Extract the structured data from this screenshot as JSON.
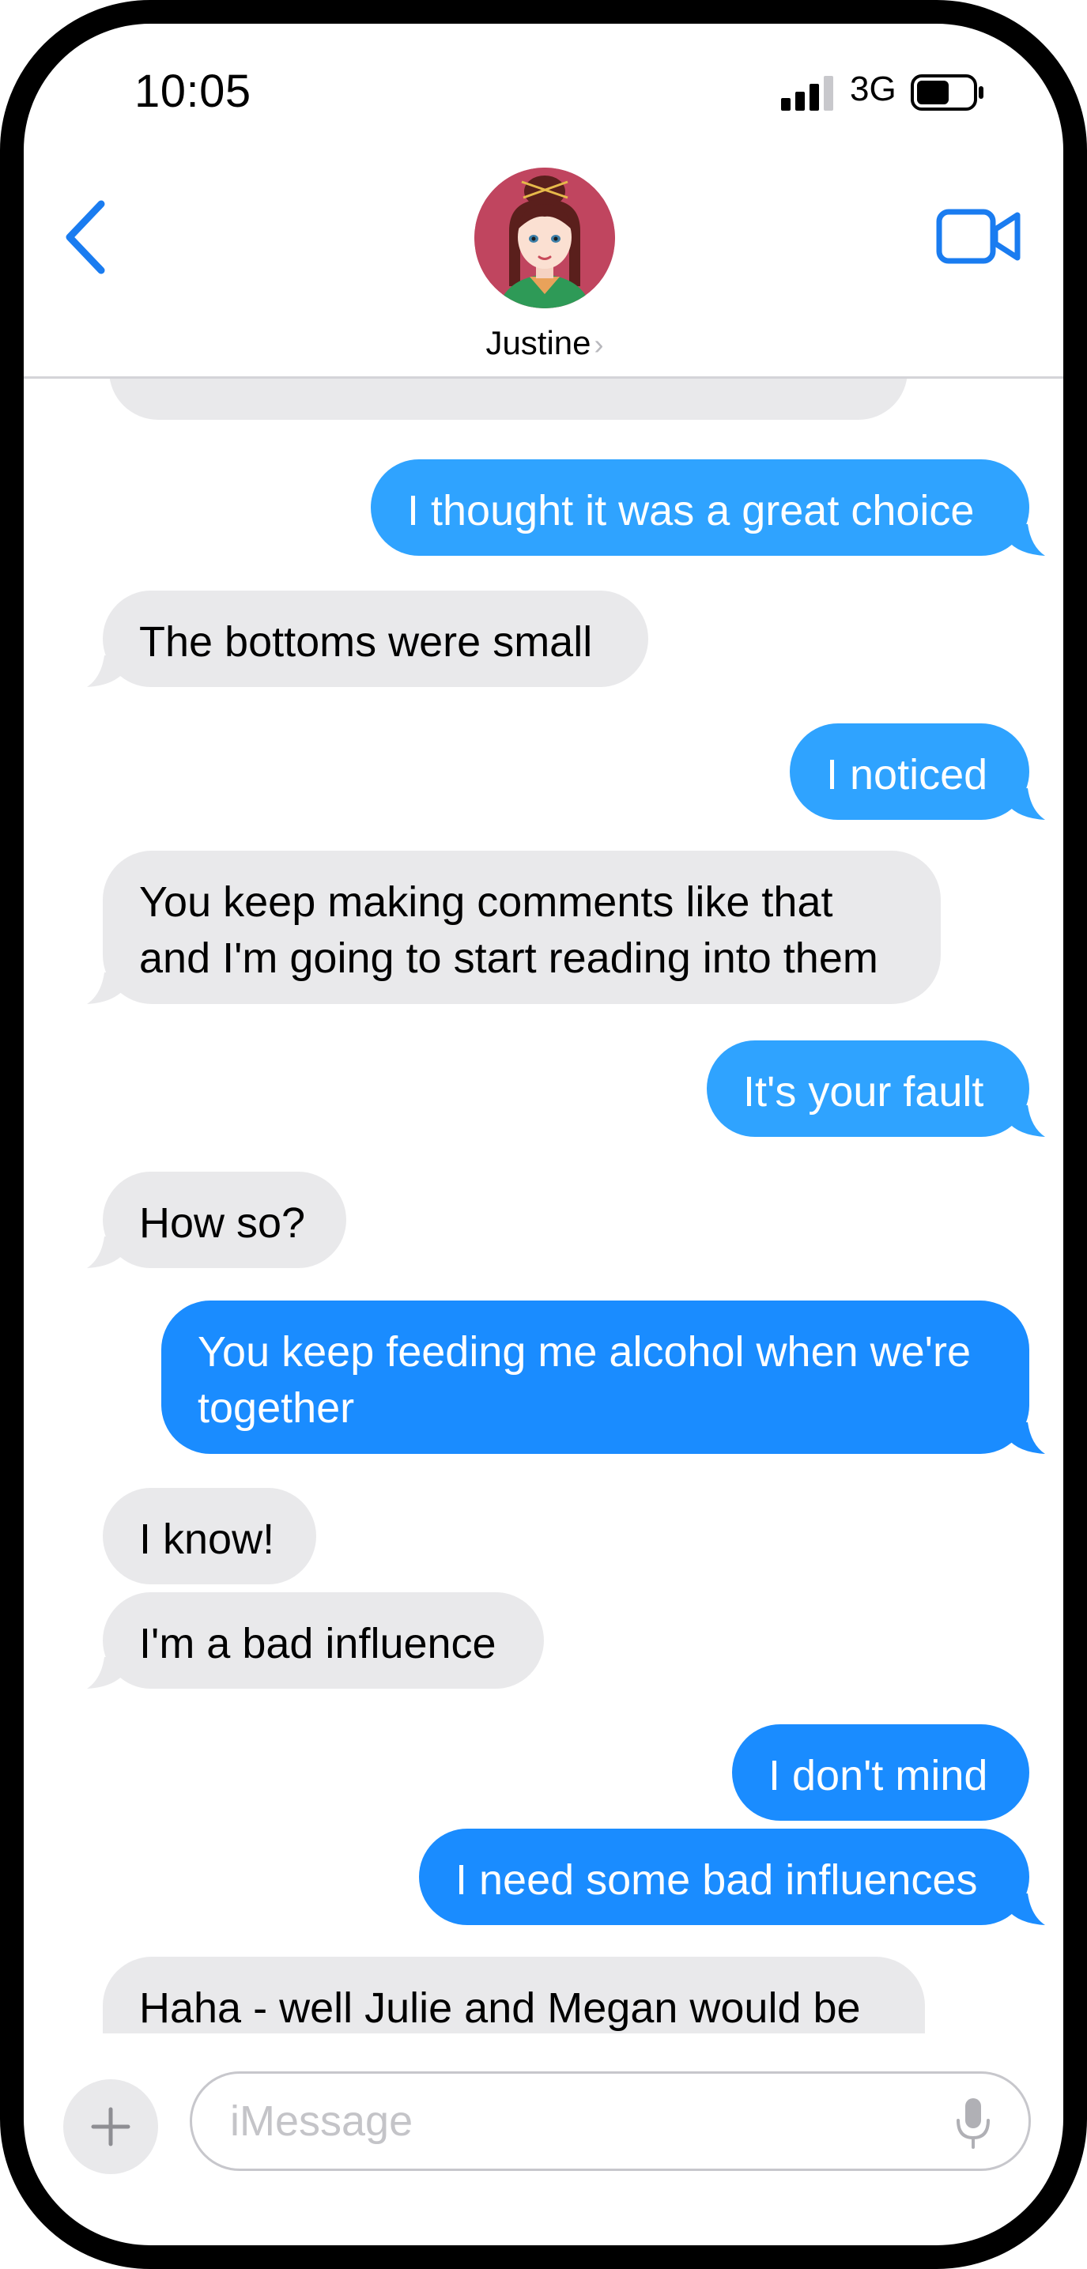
{
  "status_bar": {
    "time": "10:05",
    "network": "3G"
  },
  "header": {
    "contact_name": "Justine",
    "chevron": "›"
  },
  "messages": [
    {
      "side": "received",
      "text": ""
    },
    {
      "side": "sent",
      "text": "I thought it was a great choice"
    },
    {
      "side": "received",
      "text": "The bottoms were small"
    },
    {
      "side": "sent",
      "text": "I noticed"
    },
    {
      "side": "received",
      "lines": [
        "You keep making comments like that",
        "and I'm going to start reading into them"
      ]
    },
    {
      "side": "sent",
      "text": "It's your fault"
    },
    {
      "side": "received",
      "text": "How so?"
    },
    {
      "side": "sent",
      "lines": [
        "You keep feeding me alcohol when we're",
        "together"
      ]
    },
    {
      "side": "received",
      "text": "I know!"
    },
    {
      "side": "received",
      "text": "I'm a bad influence"
    },
    {
      "side": "sent",
      "text": "I don't mind"
    },
    {
      "side": "sent",
      "text": "I need some bad influences"
    },
    {
      "side": "received",
      "text": "Haha - well Julie and Megan would be"
    }
  ],
  "composer": {
    "placeholder": "iMessage"
  },
  "colors": {
    "sent_bubble": "#1a8cff",
    "received_bubble": "#e9e9eb",
    "accent": "#1a7cf0"
  },
  "icons": [
    "back-chevron-icon",
    "video-camera-icon",
    "plus-icon",
    "microphone-icon",
    "signal-icon",
    "battery-icon"
  ]
}
